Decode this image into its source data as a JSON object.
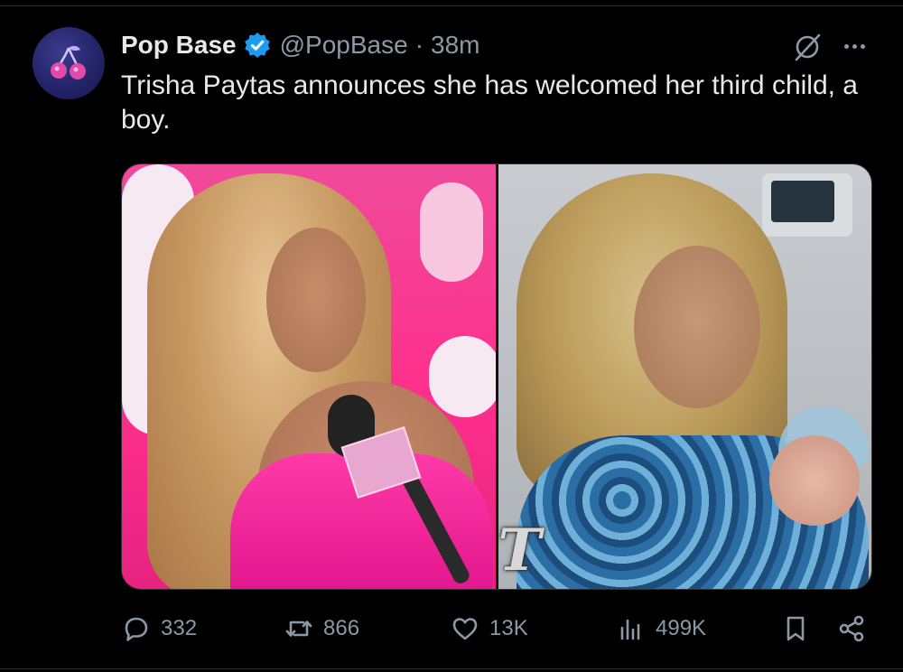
{
  "post": {
    "author": {
      "display_name": "Pop Base",
      "handle": "@PopBase",
      "verified": true,
      "avatar_icon": "cherry-icon"
    },
    "separator": "·",
    "time": "38m",
    "text": "Trisha Paytas announces she has welcomed her third child, a boy.",
    "media_overlay_text": "T"
  },
  "actions": {
    "reply_count": "332",
    "repost_count": "866",
    "like_count": "13K",
    "views_count": "499K"
  },
  "colors": {
    "background": "#000000",
    "text": "#e7e9ea",
    "muted": "#8b98a5",
    "verified": "#1d9bf0"
  }
}
